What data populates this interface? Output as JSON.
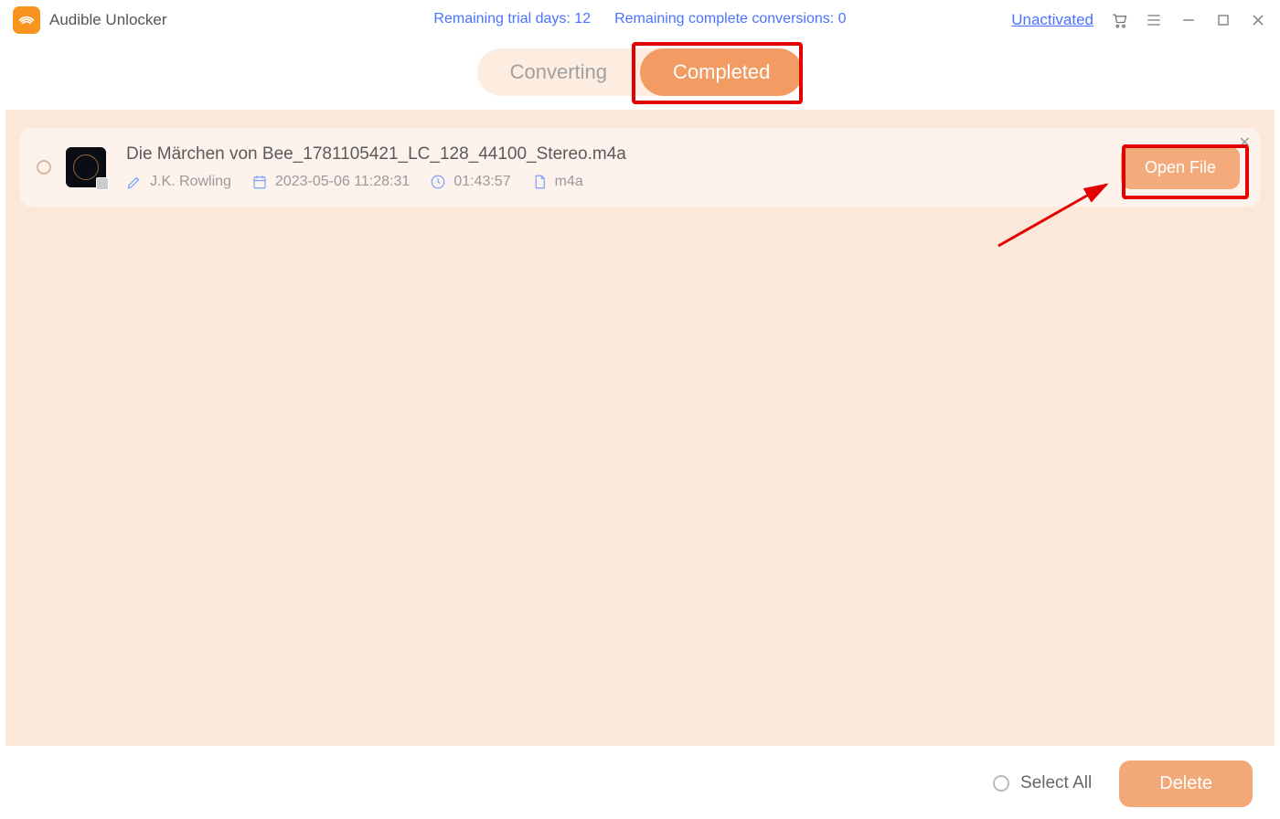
{
  "app": {
    "title": "Audible Unlocker"
  },
  "status": {
    "trial_label": "Remaining trial days:",
    "trial_value": "12",
    "conv_label": "Remaining complete conversions:",
    "conv_value": "0",
    "unactivated": "Unactivated"
  },
  "tabs": {
    "converting": "Converting",
    "completed": "Completed"
  },
  "item": {
    "title": "Die Märchen von Bee_1781105421_LC_128_44100_Stereo.m4a",
    "author": "J.K. Rowling",
    "date": "2023-05-06 11:28:31",
    "duration": "01:43:57",
    "format": "m4a",
    "open_file": "Open File"
  },
  "footer": {
    "select_all": "Select All",
    "delete": "Delete"
  }
}
